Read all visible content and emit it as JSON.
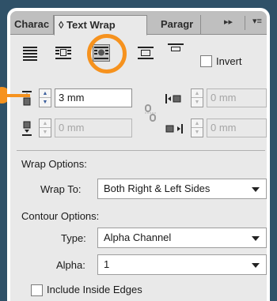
{
  "tabs": [
    {
      "label": "Charac"
    },
    {
      "label": "Text Wrap",
      "icon": "up-down-arrows-icon"
    },
    {
      "label": "Paragr"
    }
  ],
  "tab_controls": {
    "collapse": "▸▸",
    "menu": "▾≡"
  },
  "wrap_icons": [
    "no-wrap-icon",
    "wrap-bounding-box-icon",
    "wrap-object-shape-icon",
    "jump-object-icon",
    "jump-to-next-column-icon"
  ],
  "invert_label": "Invert",
  "offsets": {
    "top": {
      "value": "3 mm",
      "icon": "top-offset-icon"
    },
    "bottom": {
      "value": "0 mm",
      "icon": "bottom-offset-icon"
    },
    "left": {
      "value": "0 mm",
      "icon": "left-offset-icon"
    },
    "right": {
      "value": "0 mm",
      "icon": "right-offset-icon"
    },
    "link_icon": "chain-link-icon"
  },
  "wrap_options": {
    "heading": "Wrap Options:",
    "wrap_to_label": "Wrap To:",
    "wrap_to_value": "Both Right & Left Sides"
  },
  "contour_options": {
    "heading": "Contour Options:",
    "type_label": "Type:",
    "type_value": "Alpha Channel",
    "alpha_label": "Alpha:",
    "alpha_value": "1"
  },
  "include_inside_edges": "Include Inside Edges",
  "colors": {
    "highlight": "#f6921e",
    "background": "#2f5168",
    "panel": "#e9e9e9"
  }
}
